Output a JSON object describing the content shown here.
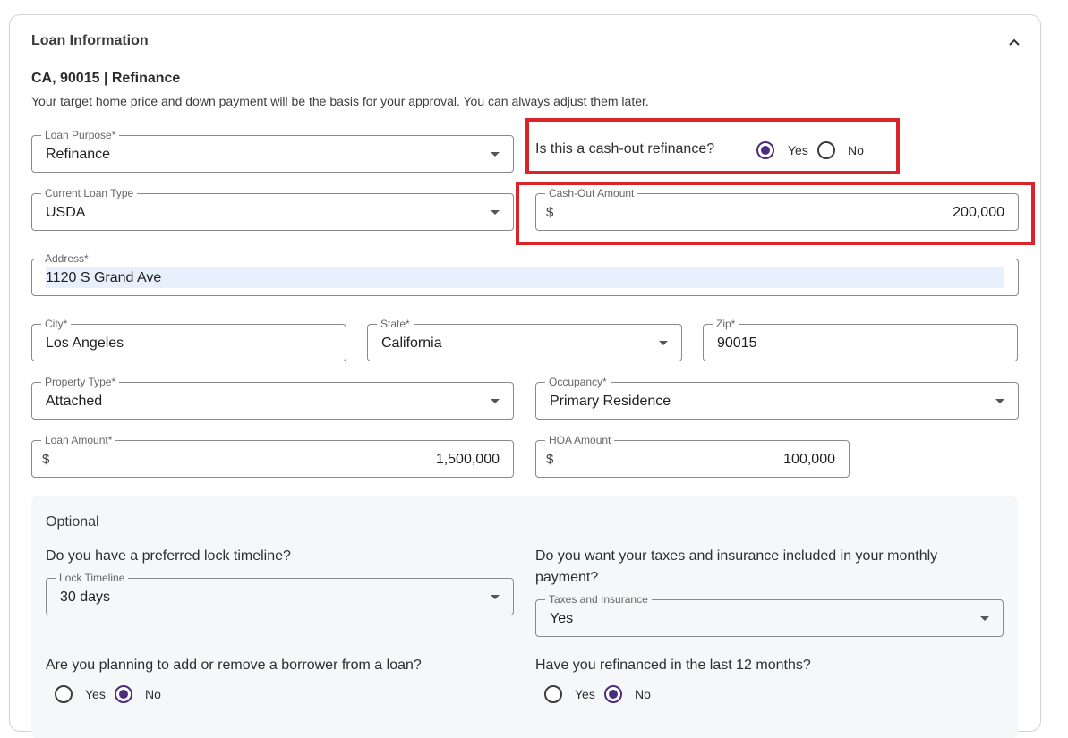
{
  "section": {
    "title": "Loan Information",
    "subtitle": "CA, 90015 | Refinance",
    "description": "Your target home price and down payment will be the basis for your approval. You can always adjust them later."
  },
  "loan_purpose": {
    "label": "Loan Purpose*",
    "value": "Refinance"
  },
  "cash_out": {
    "question": "Is this a cash-out refinance?",
    "yes": "Yes",
    "no": "No",
    "selected": "Yes"
  },
  "current_loan_type": {
    "label": "Current Loan Type",
    "value": "USDA"
  },
  "cash_out_amount": {
    "label": "Cash-Out Amount",
    "prefix": "$",
    "value": "200,000"
  },
  "address": {
    "label": "Address*",
    "value": "1120 S Grand Ave"
  },
  "city": {
    "label": "City*",
    "value": "Los Angeles"
  },
  "state": {
    "label": "State*",
    "value": "California"
  },
  "zip": {
    "label": "Zip*",
    "value": "90015"
  },
  "property_type": {
    "label": "Property Type*",
    "value": "Attached"
  },
  "occupancy": {
    "label": "Occupancy*",
    "value": "Primary Residence"
  },
  "loan_amount": {
    "label": "Loan Amount*",
    "prefix": "$",
    "value": "1,500,000"
  },
  "hoa_amount": {
    "label": "HOA Amount",
    "prefix": "$",
    "value": "100,000"
  },
  "optional": {
    "title": "Optional",
    "lock_question": "Do you have a preferred lock timeline?",
    "lock_timeline": {
      "label": "Lock Timeline",
      "value": "30 days"
    },
    "taxes_question": "Do you want your taxes and insurance included in your monthly payment?",
    "taxes_insurance": {
      "label": "Taxes and Insurance",
      "value": "Yes"
    },
    "borrower_question": "Are you planning to add or remove a borrower from a loan?",
    "borrower": {
      "yes": "Yes",
      "no": "No",
      "selected": "No"
    },
    "refinanced_question": "Have you refinanced in the last 12 months?",
    "refinanced": {
      "yes": "Yes",
      "no": "No",
      "selected": "No"
    }
  },
  "colors": {
    "accent": "#4a2e7d",
    "highlight": "#d8242a",
    "autofill": "#e8f0fe",
    "optional_bg": "#f6f7f9"
  }
}
